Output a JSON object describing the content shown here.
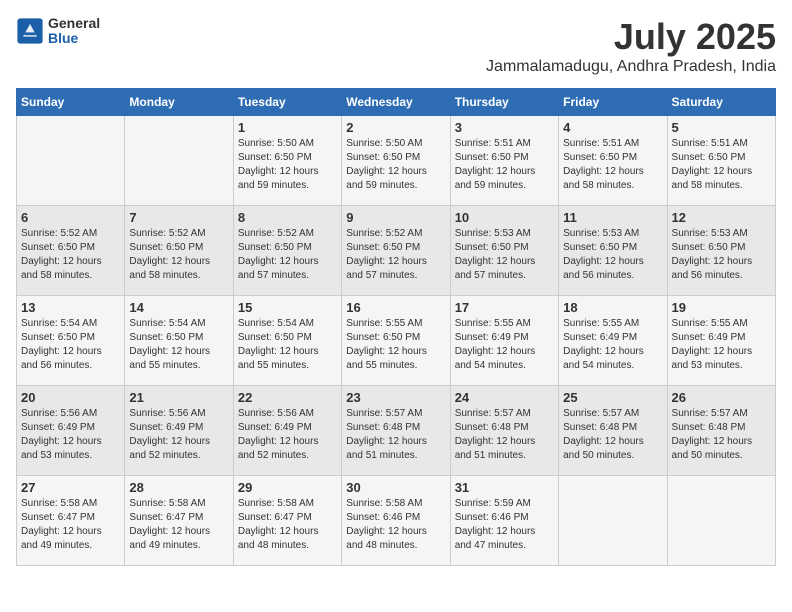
{
  "header": {
    "logo_general": "General",
    "logo_blue": "Blue",
    "month_year": "July 2025",
    "location": "Jammalamadugu, Andhra Pradesh, India"
  },
  "calendar": {
    "days_of_week": [
      "Sunday",
      "Monday",
      "Tuesday",
      "Wednesday",
      "Thursday",
      "Friday",
      "Saturday"
    ],
    "weeks": [
      [
        {
          "day": "",
          "info": ""
        },
        {
          "day": "",
          "info": ""
        },
        {
          "day": "1",
          "info": "Sunrise: 5:50 AM\nSunset: 6:50 PM\nDaylight: 12 hours\nand 59 minutes."
        },
        {
          "day": "2",
          "info": "Sunrise: 5:50 AM\nSunset: 6:50 PM\nDaylight: 12 hours\nand 59 minutes."
        },
        {
          "day": "3",
          "info": "Sunrise: 5:51 AM\nSunset: 6:50 PM\nDaylight: 12 hours\nand 59 minutes."
        },
        {
          "day": "4",
          "info": "Sunrise: 5:51 AM\nSunset: 6:50 PM\nDaylight: 12 hours\nand 58 minutes."
        },
        {
          "day": "5",
          "info": "Sunrise: 5:51 AM\nSunset: 6:50 PM\nDaylight: 12 hours\nand 58 minutes."
        }
      ],
      [
        {
          "day": "6",
          "info": "Sunrise: 5:52 AM\nSunset: 6:50 PM\nDaylight: 12 hours\nand 58 minutes."
        },
        {
          "day": "7",
          "info": "Sunrise: 5:52 AM\nSunset: 6:50 PM\nDaylight: 12 hours\nand 58 minutes."
        },
        {
          "day": "8",
          "info": "Sunrise: 5:52 AM\nSunset: 6:50 PM\nDaylight: 12 hours\nand 57 minutes."
        },
        {
          "day": "9",
          "info": "Sunrise: 5:52 AM\nSunset: 6:50 PM\nDaylight: 12 hours\nand 57 minutes."
        },
        {
          "day": "10",
          "info": "Sunrise: 5:53 AM\nSunset: 6:50 PM\nDaylight: 12 hours\nand 57 minutes."
        },
        {
          "day": "11",
          "info": "Sunrise: 5:53 AM\nSunset: 6:50 PM\nDaylight: 12 hours\nand 56 minutes."
        },
        {
          "day": "12",
          "info": "Sunrise: 5:53 AM\nSunset: 6:50 PM\nDaylight: 12 hours\nand 56 minutes."
        }
      ],
      [
        {
          "day": "13",
          "info": "Sunrise: 5:54 AM\nSunset: 6:50 PM\nDaylight: 12 hours\nand 56 minutes."
        },
        {
          "day": "14",
          "info": "Sunrise: 5:54 AM\nSunset: 6:50 PM\nDaylight: 12 hours\nand 55 minutes."
        },
        {
          "day": "15",
          "info": "Sunrise: 5:54 AM\nSunset: 6:50 PM\nDaylight: 12 hours\nand 55 minutes."
        },
        {
          "day": "16",
          "info": "Sunrise: 5:55 AM\nSunset: 6:50 PM\nDaylight: 12 hours\nand 55 minutes."
        },
        {
          "day": "17",
          "info": "Sunrise: 5:55 AM\nSunset: 6:49 PM\nDaylight: 12 hours\nand 54 minutes."
        },
        {
          "day": "18",
          "info": "Sunrise: 5:55 AM\nSunset: 6:49 PM\nDaylight: 12 hours\nand 54 minutes."
        },
        {
          "day": "19",
          "info": "Sunrise: 5:55 AM\nSunset: 6:49 PM\nDaylight: 12 hours\nand 53 minutes."
        }
      ],
      [
        {
          "day": "20",
          "info": "Sunrise: 5:56 AM\nSunset: 6:49 PM\nDaylight: 12 hours\nand 53 minutes."
        },
        {
          "day": "21",
          "info": "Sunrise: 5:56 AM\nSunset: 6:49 PM\nDaylight: 12 hours\nand 52 minutes."
        },
        {
          "day": "22",
          "info": "Sunrise: 5:56 AM\nSunset: 6:49 PM\nDaylight: 12 hours\nand 52 minutes."
        },
        {
          "day": "23",
          "info": "Sunrise: 5:57 AM\nSunset: 6:48 PM\nDaylight: 12 hours\nand 51 minutes."
        },
        {
          "day": "24",
          "info": "Sunrise: 5:57 AM\nSunset: 6:48 PM\nDaylight: 12 hours\nand 51 minutes."
        },
        {
          "day": "25",
          "info": "Sunrise: 5:57 AM\nSunset: 6:48 PM\nDaylight: 12 hours\nand 50 minutes."
        },
        {
          "day": "26",
          "info": "Sunrise: 5:57 AM\nSunset: 6:48 PM\nDaylight: 12 hours\nand 50 minutes."
        }
      ],
      [
        {
          "day": "27",
          "info": "Sunrise: 5:58 AM\nSunset: 6:47 PM\nDaylight: 12 hours\nand 49 minutes."
        },
        {
          "day": "28",
          "info": "Sunrise: 5:58 AM\nSunset: 6:47 PM\nDaylight: 12 hours\nand 49 minutes."
        },
        {
          "day": "29",
          "info": "Sunrise: 5:58 AM\nSunset: 6:47 PM\nDaylight: 12 hours\nand 48 minutes."
        },
        {
          "day": "30",
          "info": "Sunrise: 5:58 AM\nSunset: 6:46 PM\nDaylight: 12 hours\nand 48 minutes."
        },
        {
          "day": "31",
          "info": "Sunrise: 5:59 AM\nSunset: 6:46 PM\nDaylight: 12 hours\nand 47 minutes."
        },
        {
          "day": "",
          "info": ""
        },
        {
          "day": "",
          "info": ""
        }
      ]
    ]
  }
}
